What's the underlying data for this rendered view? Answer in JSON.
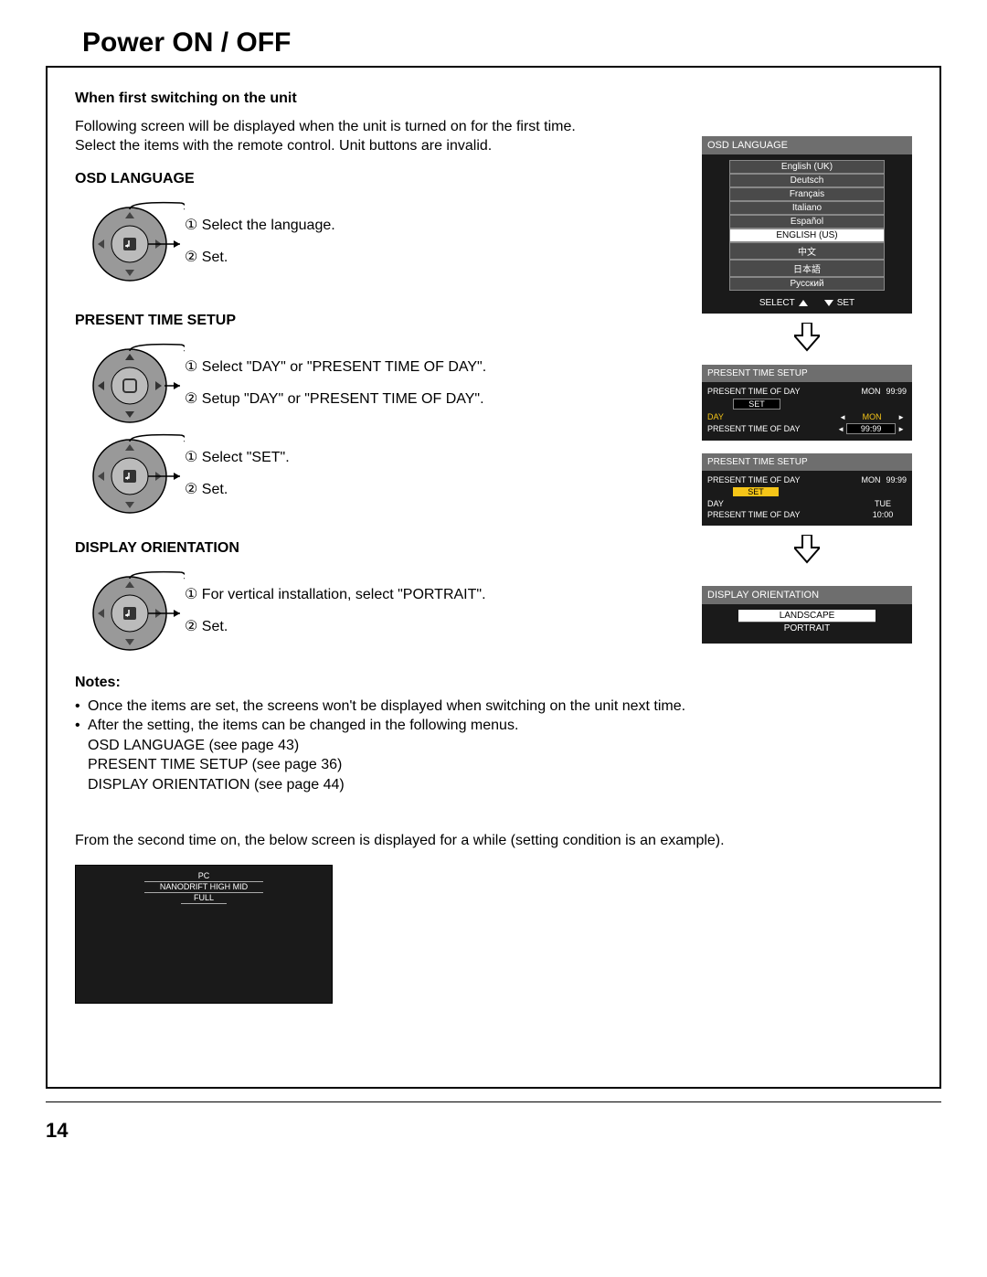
{
  "page": {
    "title": "Power ON / OFF",
    "number": "14"
  },
  "intro": {
    "heading": "When first switching on the unit",
    "p1": "Following screen will be displayed when the unit is turned on for the first time.",
    "p2": "Select the items with the remote control. Unit buttons are invalid."
  },
  "osd_lang": {
    "heading": "OSD LANGUAGE",
    "step1": "Select the language.",
    "step2": "Set.",
    "panel_title": "OSD LANGUAGE",
    "items": [
      "English (UK)",
      "Deutsch",
      "Français",
      "Italiano",
      "Español",
      "ENGLISH (US)",
      "中文",
      "日本語",
      "Русский"
    ],
    "selected_index": 5,
    "footer_left": "SELECT",
    "footer_right": "SET"
  },
  "pts": {
    "heading": "PRESENT TIME SETUP",
    "a_step1": "Select \"DAY\" or \"PRESENT TIME OF DAY\".",
    "a_step2": "Setup \"DAY\" or \"PRESENT TIME OF DAY\".",
    "b_step1": "Select \"SET\".",
    "b_step2": "Set.",
    "panel1": {
      "title": "PRESENT TIME SETUP",
      "line_top_label": "PRESENT TIME OF DAY",
      "line_top_day": "MON",
      "line_top_time": "99:99",
      "set_label": "SET",
      "day_label": "DAY",
      "day_value": "MON",
      "ptod_label": "PRESENT TIME OF DAY",
      "ptod_value": "99:99"
    },
    "panel2": {
      "title": "PRESENT TIME SETUP",
      "line_top_label": "PRESENT TIME OF DAY",
      "line_top_day": "MON",
      "line_top_time": "99:99",
      "set_label": "SET",
      "day_label": "DAY",
      "day_value": "TUE",
      "ptod_label": "PRESENT TIME OF DAY",
      "ptod_value": "10:00"
    }
  },
  "display_orient": {
    "heading": "DISPLAY ORIENTATION",
    "step1": "For vertical installation, select \"PORTRAIT\".",
    "step2": "Set.",
    "panel_title": "DISPLAY ORIENTATION",
    "opt1": "LANDSCAPE",
    "opt2": "PORTRAIT"
  },
  "notes": {
    "heading": "Notes:",
    "n1": "Once the items are set, the screens won't be displayed when switching on the unit next time.",
    "n2": "After the setting, the items can be changed in the following menus.",
    "n2a": "OSD LANGUAGE (see page 43)",
    "n2b": "PRESENT TIME SETUP (see page 36)",
    "n2c": "DISPLAY ORIENTATION (see page 44)"
  },
  "second_time": {
    "text": "From the second time on, the below screen is displayed for a while (setting condition is an example).",
    "mini_line1": "PC",
    "mini_line2": "NANODRIFT  HIGH MID",
    "mini_line3": "FULL"
  }
}
